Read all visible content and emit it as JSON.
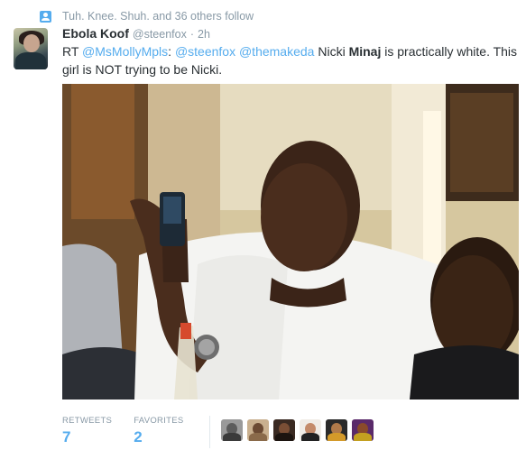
{
  "context": {
    "icon": "follow-person-icon",
    "text": "Tuh. Knee. Shuh. and 36 others follow",
    "accent": "#55acee"
  },
  "tweet": {
    "author_name": "Ebola Koof",
    "handle": "@steenfox",
    "separator": "·",
    "time": "2h",
    "text": {
      "rt": "RT ",
      "mention1": "@MsMollyMpls",
      "colon": ": ",
      "mention2": "@steenfox",
      "space": " ",
      "mention3": "@themakeda",
      "pre": " Nicki ",
      "bold": "Minaj",
      "post": " is practically white. This girl is NOT trying to be Nicki."
    }
  },
  "stats": {
    "retweets_label": "RETWEETS",
    "retweets_value": "7",
    "favorites_label": "FAVORITES",
    "favorites_value": "2"
  },
  "favoriters": [
    {
      "name": "favoriter-avatar-1"
    },
    {
      "name": "favoriter-avatar-2"
    },
    {
      "name": "favoriter-avatar-3"
    },
    {
      "name": "favoriter-avatar-4"
    },
    {
      "name": "favoriter-avatar-5"
    },
    {
      "name": "favoriter-avatar-6"
    }
  ],
  "colors": {
    "link": "#55acee",
    "muted": "#8899a6",
    "text": "#292f33"
  }
}
